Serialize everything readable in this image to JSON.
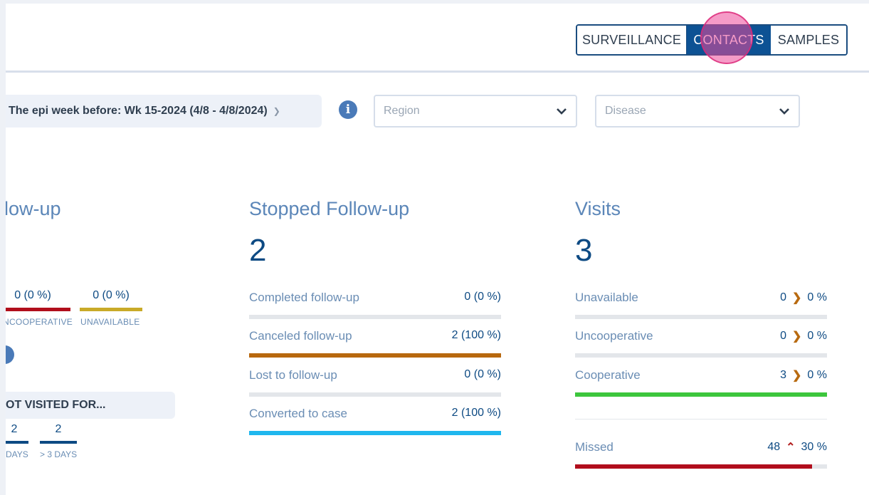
{
  "nav": {
    "tabs": [
      {
        "label": "SURVEILLANCE",
        "active": false
      },
      {
        "label": "CONTACTS",
        "active": true
      },
      {
        "label": "SAMPLES",
        "active": false
      }
    ]
  },
  "filters": {
    "epi_week": "The epi week before: Wk 15-2024 (4/8 - 4/8/2024)",
    "region_placeholder": "Region",
    "disease_placeholder": "Disease"
  },
  "under_followup": {
    "title": "llow-up",
    "stats": [
      {
        "value": "0 (0 %)",
        "label": "NCOOPERATIVE",
        "color": "#b10e1c"
      },
      {
        "value": "0 (0 %)",
        "label": "UNAVAILABLE",
        "color": "#c9aa28"
      }
    ],
    "not_visited_title": "OT VISITED FOR...",
    "not_visited": [
      {
        "value": "2",
        "label": "DAYS"
      },
      {
        "value": "2",
        "label": "> 3 DAYS"
      }
    ]
  },
  "stopped_followup": {
    "title": "Stopped Follow-up",
    "count": "2",
    "rows": [
      {
        "label": "Completed follow-up",
        "value": "0 (0 %)",
        "fraction": 0,
        "color": "#e3e6ea"
      },
      {
        "label": "Canceled follow-up",
        "value": "2 (100 %)",
        "fraction": 1,
        "color": "#b8680e"
      },
      {
        "label": "Lost to follow-up",
        "value": "0 (0 %)",
        "fraction": 0,
        "color": "#e3e6ea"
      },
      {
        "label": "Converted to case",
        "value": "2 (100 %)",
        "fraction": 1,
        "color": "#1fb7ee"
      }
    ]
  },
  "visits": {
    "title": "Visits",
    "count": "3",
    "rows": [
      {
        "label": "Unavailable",
        "count": "0",
        "trend": "right-arrow",
        "pct": "0 %",
        "fraction": 0,
        "color": "#e3e6ea"
      },
      {
        "label": "Uncooperative",
        "count": "0",
        "trend": "right-arrow",
        "pct": "0 %",
        "fraction": 0,
        "color": "#e3e6ea"
      },
      {
        "label": "Cooperative",
        "count": "3",
        "trend": "right-arrow",
        "pct": "0 %",
        "fraction": 1,
        "color": "#3cc63c"
      }
    ],
    "missed": {
      "label": "Missed",
      "count": "48",
      "trend": "up-arrow",
      "pct": "30 %",
      "fraction": 0.94,
      "color": "#b10e1c"
    }
  }
}
